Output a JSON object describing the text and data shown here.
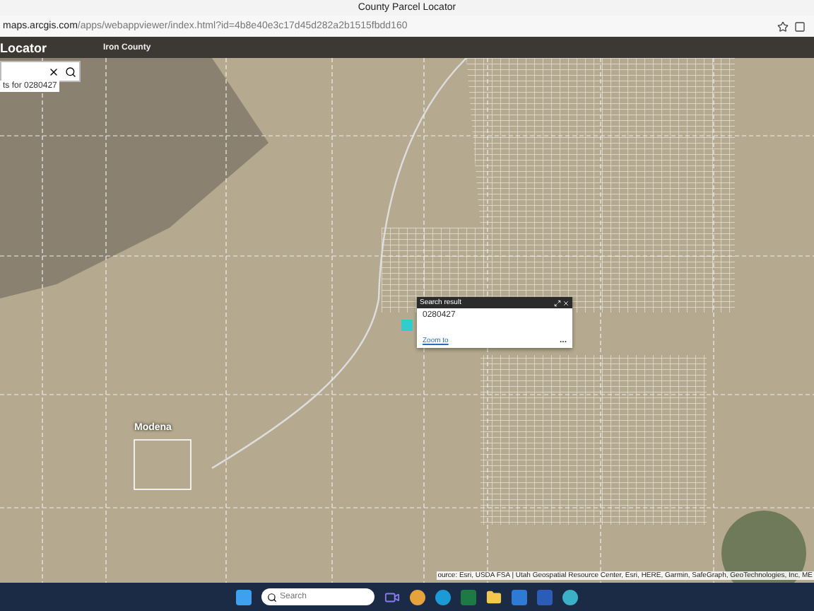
{
  "browser": {
    "tab_title": "County Parcel Locator",
    "url_host": "maps.arcgis.com",
    "url_path": "/apps/webappviewer/index.html?id=4b8e40e3c17d45d282a2b1515fbdd160"
  },
  "header": {
    "title": "Locator",
    "subtitle": "Iron County"
  },
  "search": {
    "hint": "ts for 0280427"
  },
  "popup": {
    "title": "Search result",
    "parcel": "0280427",
    "link": "Zoom to",
    "more": "..."
  },
  "map_labels": [
    "Modena"
  ],
  "attribution": "ource: Esri, USDA FSA | Utah Geospatial Resource Center, Esri, HERE, Garmin, SafeGraph, GeoTechnologies, Inc, ME",
  "taskbar": {
    "search_placeholder": "Search"
  }
}
